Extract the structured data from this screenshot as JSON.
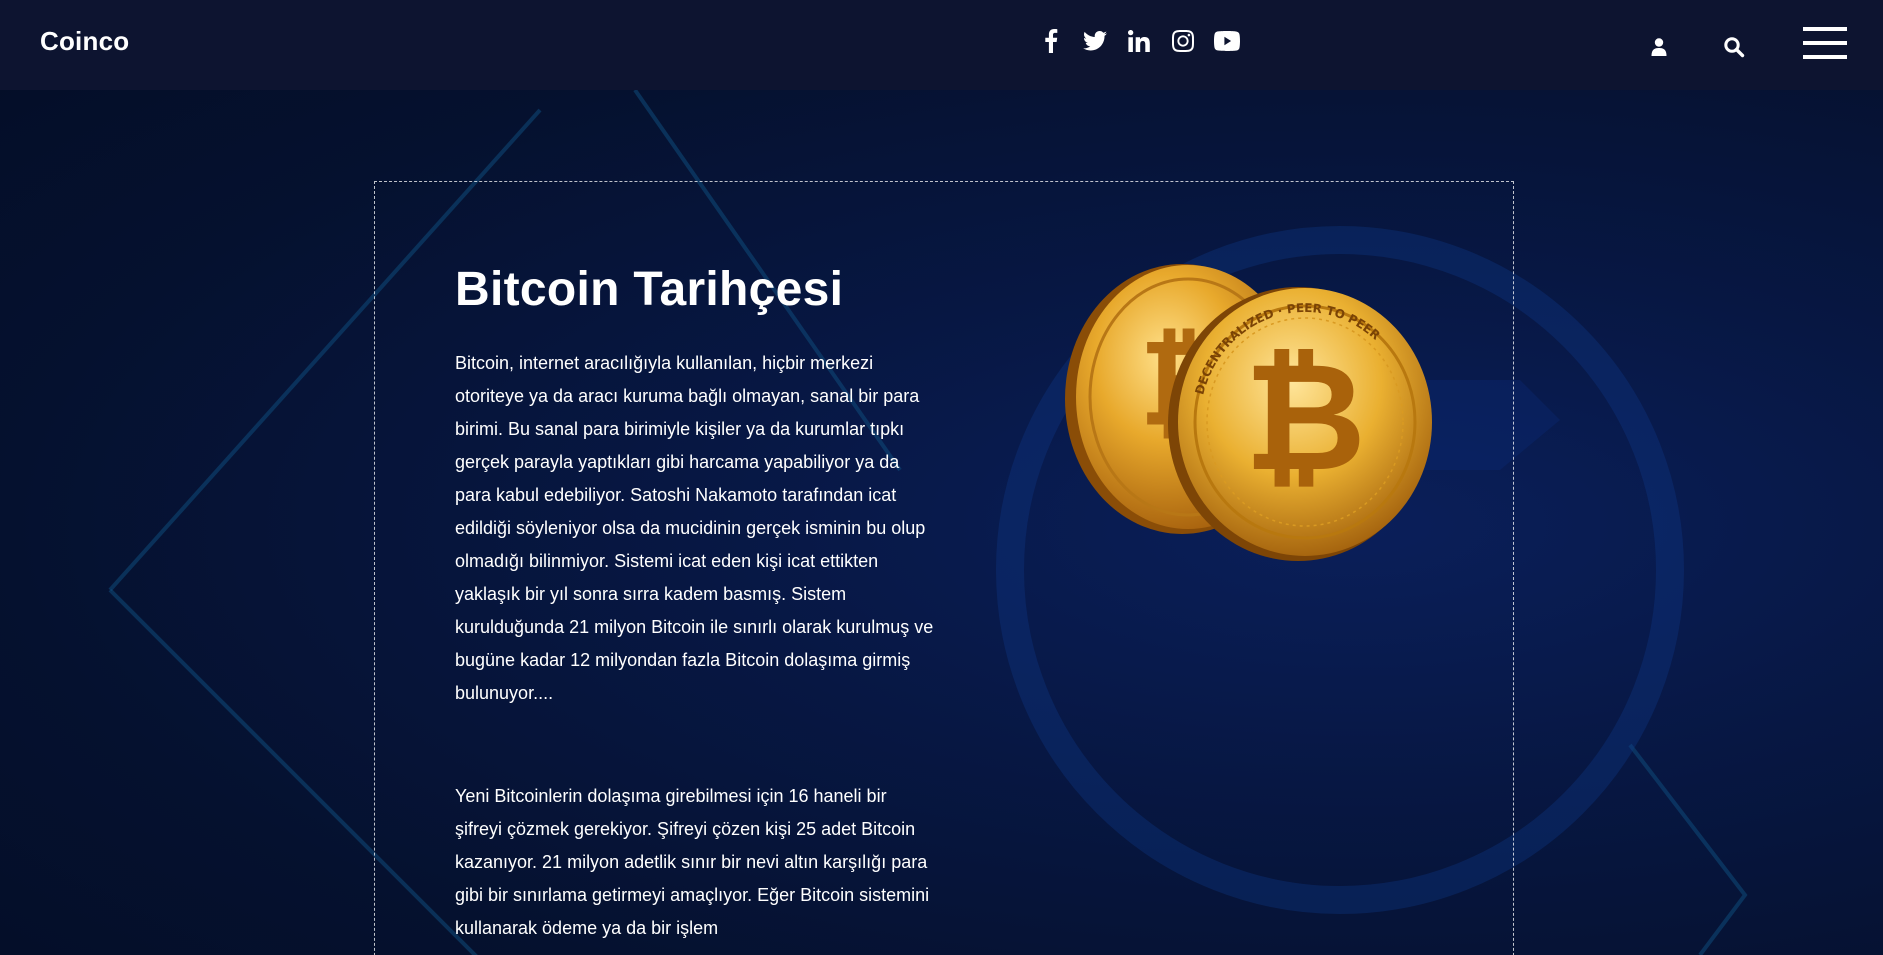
{
  "header": {
    "logo": "Coinco",
    "social_icons": [
      "facebook-icon",
      "twitter-icon",
      "linkedin-icon",
      "instagram-icon",
      "youtube-icon"
    ],
    "user_icon": "user-icon",
    "search_icon": "search-icon",
    "menu_icon": "hamburger-menu-icon"
  },
  "main": {
    "title": "Bitcoin Tarihçesi",
    "paragraph_1": "Bitcoin, internet aracılığıyla kullanılan, hiçbir merkezi otoriteye ya da aracı kuruma bağlı olmayan, sanal bir para birimi. Bu sanal para birimiyle kişiler ya da kurumlar tıpkı gerçek parayla yaptıkları gibi harcama yapabiliyor ya da para kabul edebiliyor. Satoshi Nakamoto tarafından icat edildiği söyleniyor olsa da mucidinin gerçek isminin bu olup olmadığı bilinmiyor. Sistemi icat eden kişi icat ettikten yaklaşık bir yıl sonra sırra kadem basmış. Sistem kurulduğunda 21 milyon Bitcoin ile sınırlı olarak kurulmuş ve bugüne kadar 12 milyondan fazla Bitcoin dolaşıma girmiş bulunuyor....",
    "paragraph_2": "Yeni Bitcoinlerin dolaşıma girebilmesi için 16 haneli bir şifreyi çözmek gerekiyor. Şifreyi çözen kişi 25 adet Bitcoin kazanıyor. 21 milyon adetlik sınır bir nevi altın karşılığı para gibi bir sınırlama getirmeyi amaçlıyor. Eğer Bitcoin sistemini kullanarak ödeme ya da bir işlem",
    "image": "bitcoin-coins-image",
    "coin_text": "DECENTRALIZED · PEER TO PEER"
  },
  "colors": {
    "header_bg": "#0d1430",
    "page_bg": "#061232",
    "text": "#ffffff",
    "coin_gold": "#e0a526"
  }
}
